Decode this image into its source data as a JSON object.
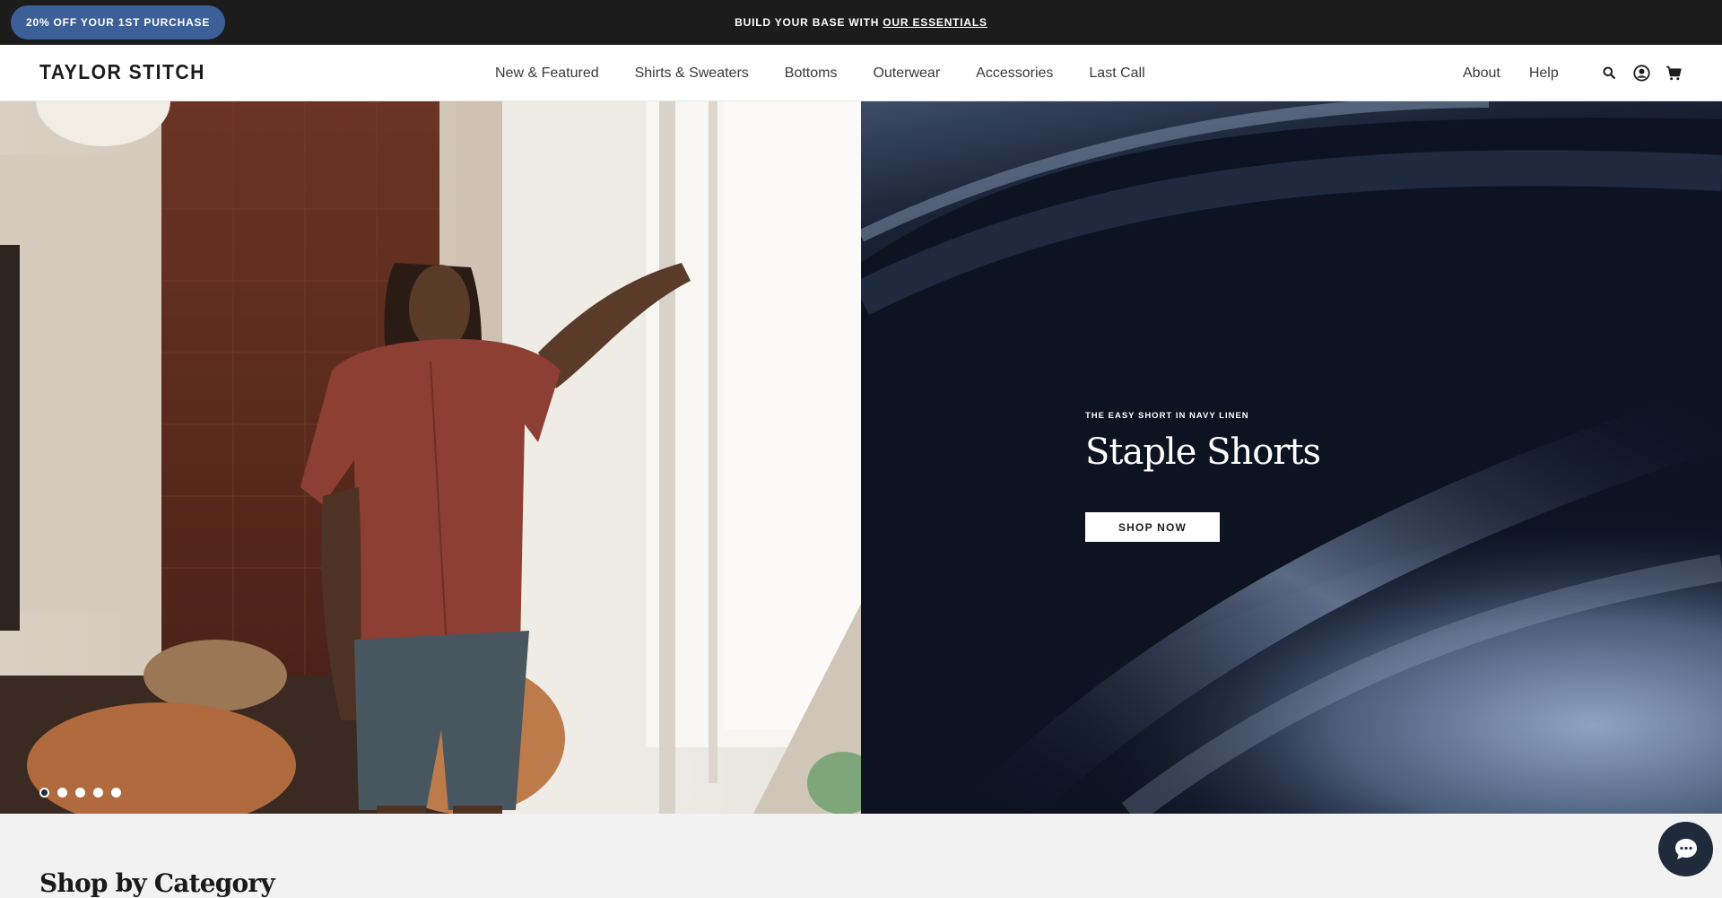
{
  "promo": {
    "pill_label": "20% OFF YOUR 1ST PURCHASE",
    "message_prefix": "BUILD YOUR BASE WITH",
    "message_link": "OUR ESSENTIALS"
  },
  "header": {
    "logo": "TAYLOR STITCH",
    "nav": [
      {
        "label": "New & Featured"
      },
      {
        "label": "Shirts & Sweaters"
      },
      {
        "label": "Bottoms"
      },
      {
        "label": "Outerwear"
      },
      {
        "label": "Accessories"
      },
      {
        "label": "Last Call"
      }
    ],
    "utility": [
      {
        "label": "About"
      },
      {
        "label": "Help"
      }
    ],
    "icons": [
      "search-icon",
      "account-icon",
      "cart-icon"
    ]
  },
  "hero": {
    "eyebrow": "THE EASY SHORT IN NAVY LINEN",
    "title": "Staple Shorts",
    "cta": "SHOP NOW",
    "slide_count": 5,
    "active_slide": 1
  },
  "category": {
    "title": "Shop by Category"
  },
  "colors": {
    "promo_bar": "#1c1c1c",
    "promo_pill": "#3b5f96",
    "chat_button": "#1f2a3a"
  }
}
